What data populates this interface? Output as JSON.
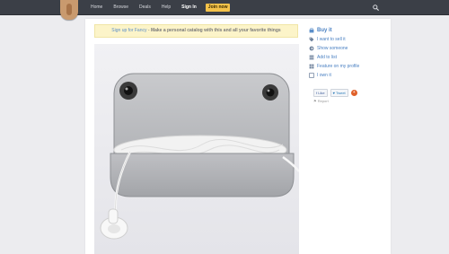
{
  "nav": {
    "items": [
      "Home",
      "Browse",
      "Deals",
      "Help"
    ],
    "sign_in": "Sign In",
    "join": "Join now"
  },
  "banner": {
    "link": "Sign up for Fancy",
    "dash": " - ",
    "text": "Make a personal catalog with this and all your favorite things"
  },
  "sidebar": {
    "buy": "Buy it",
    "want": "I want to sell it",
    "show": "Show someone",
    "add": "Add to list",
    "feature": "Feature on my profile",
    "own": "I own it"
  },
  "social": {
    "like": "Like",
    "tweet": "Tweet",
    "plus": "+",
    "report": "Report"
  },
  "icons": {
    "search": "search-icon",
    "logo": "fancy-logo",
    "buy": "bag-icon",
    "want": "tag-icon",
    "show": "share-icon",
    "add": "list-icon",
    "feature": "grid-icon",
    "own": "check-icon",
    "report": "flag-icon"
  },
  "colors": {
    "topbar": "#3b3f47",
    "accent_join": "#f4c24a",
    "link": "#4a80c2",
    "banner_bg": "#fcf4c9"
  }
}
